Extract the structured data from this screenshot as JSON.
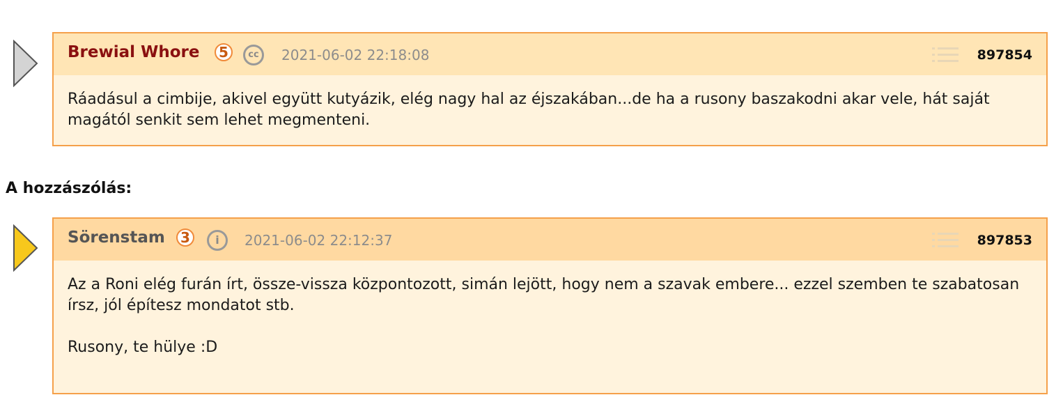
{
  "reply_post": {
    "author": "Brewial Whore",
    "rank": "5",
    "badge": "cc",
    "timestamp": "2021-06-02 22:18:08",
    "post_id": "897854",
    "body": [
      "Ráadásul a cimbije, akivel együtt kutyázik, elég nagy hal az éjszakában...de ha a rusony baszakodni akar vele, hát saját magától senkit sem lehet megmenteni."
    ],
    "arrow_color": "#d4d4d4"
  },
  "section_label": "A hozzászólás:",
  "original_post": {
    "author": "Sörenstam",
    "rank": "3",
    "badge": "i",
    "timestamp": "2021-06-02 22:12:37",
    "post_id": "897853",
    "body": [
      "Az a Roni elég furán írt, össze-vissza központozott, simán lejött, hogy nem a szavak embere... ezzel szemben te szabatosan írsz, jól építesz mondatot stb.",
      "Rusony, te hülye :D"
    ],
    "arrow_color": "#f7c81c"
  },
  "icons": {
    "arrow": "triangle-right-icon",
    "rank": "rank-circle-icon",
    "license": "creative-commons-icon",
    "info": "info-icon",
    "list": "list-icon"
  }
}
